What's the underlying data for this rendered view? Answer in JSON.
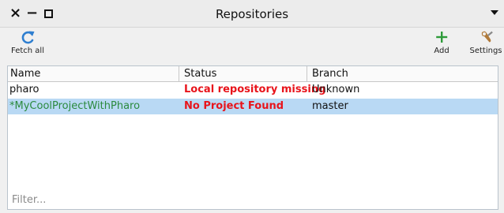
{
  "window": {
    "title": "Repositories",
    "controls": {
      "close": "×",
      "minimize": "−"
    }
  },
  "toolbar": {
    "fetch_all_label": "Fetch all",
    "add_label": "Add",
    "settings_label": "Settings"
  },
  "table": {
    "columns": [
      "Name",
      "Status",
      "Branch"
    ],
    "rows": [
      {
        "name": "pharo",
        "status": "Local repository missing",
        "branch": "Unknown",
        "selected": false
      },
      {
        "name": "*MyCoolProjectWithPharo",
        "status": "No Project Found",
        "branch": "master",
        "selected": true
      }
    ]
  },
  "filter": {
    "placeholder": "Filter...",
    "value": ""
  },
  "colors": {
    "status_error": "#e8141b",
    "modified_name": "#2b8a3e",
    "selection": "#b9d9f4",
    "refresh_icon": "#2f7fd0",
    "add_icon": "#2e9b3a"
  }
}
